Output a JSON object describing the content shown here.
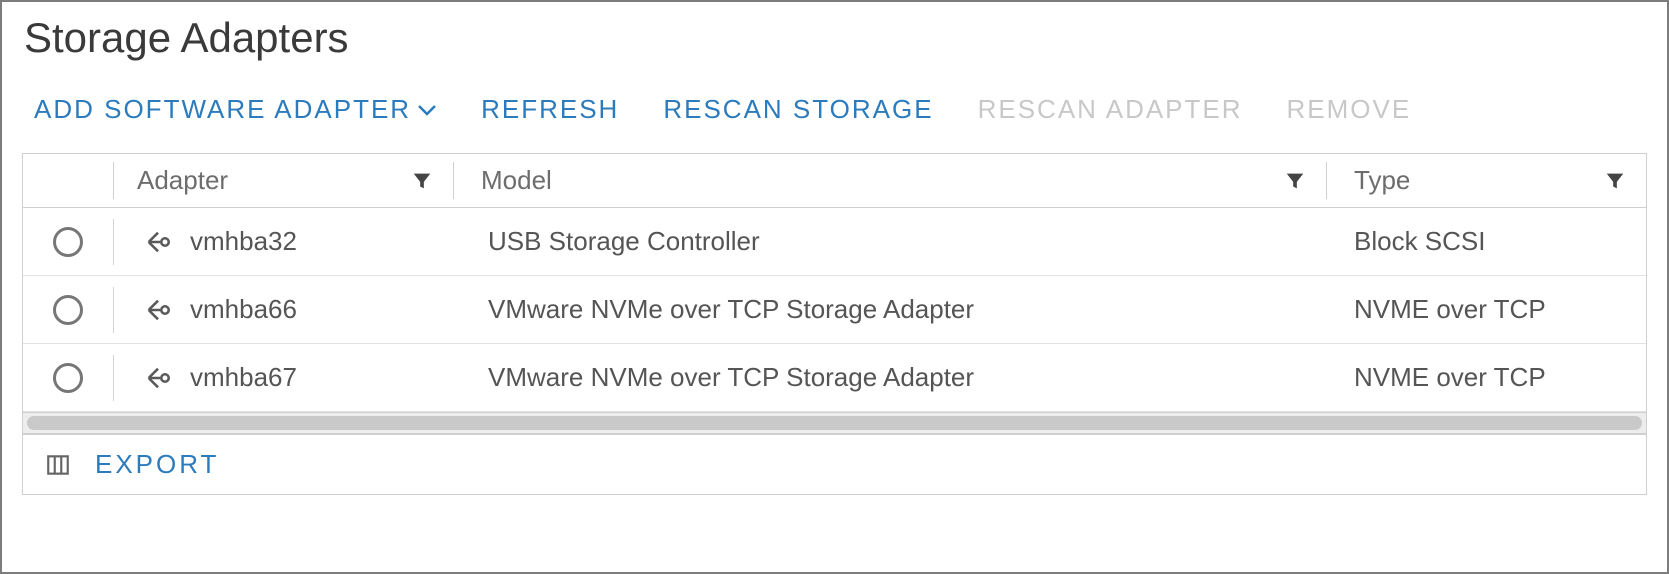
{
  "title": "Storage Adapters",
  "toolbar": {
    "add": "ADD SOFTWARE ADAPTER",
    "refresh": "REFRESH",
    "rescan_storage": "RESCAN STORAGE",
    "rescan_adapter": "RESCAN ADAPTER",
    "remove": "REMOVE"
  },
  "columns": {
    "adapter": "Adapter",
    "model": "Model",
    "type": "Type"
  },
  "rows": [
    {
      "adapter": "vmhba32",
      "model": "USB Storage Controller",
      "type": "Block SCSI"
    },
    {
      "adapter": "vmhba66",
      "model": "VMware NVMe over TCP Storage Adapter",
      "type": "NVME over TCP"
    },
    {
      "adapter": "vmhba67",
      "model": "VMware NVMe over TCP Storage Adapter",
      "type": "NVME over TCP"
    }
  ],
  "footer": {
    "export": "EXPORT"
  }
}
